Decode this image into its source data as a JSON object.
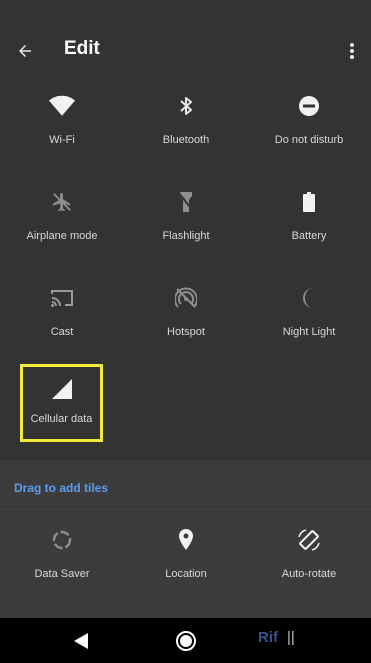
{
  "header": {
    "title": "Edit"
  },
  "tiles": [
    {
      "label": "Wi-Fi",
      "icon": "wifi-icon"
    },
    {
      "label": "Bluetooth",
      "icon": "bluetooth-icon"
    },
    {
      "label": "Do not disturb",
      "icon": "do-not-disturb-icon"
    },
    {
      "label": "Airplane mode",
      "icon": "airplane-icon"
    },
    {
      "label": "Flashlight",
      "icon": "flashlight-icon"
    },
    {
      "label": "Battery",
      "icon": "battery-icon"
    },
    {
      "label": "Cast",
      "icon": "cast-icon"
    },
    {
      "label": "Hotspot",
      "icon": "hotspot-icon"
    },
    {
      "label": "Night Light",
      "icon": "night-light-icon"
    },
    {
      "label": "Cellular data",
      "icon": "cellular-signal-icon"
    }
  ],
  "drag_section": {
    "title": "Drag to add tiles",
    "tiles": [
      {
        "label": "Data Saver",
        "icon": "data-saver-icon"
      },
      {
        "label": "Location",
        "icon": "location-icon"
      },
      {
        "label": "Auto-rotate",
        "icon": "auto-rotate-icon"
      }
    ]
  },
  "watermark": {
    "text": "Rif",
    "sub": "||"
  },
  "colors": {
    "background": "#333333",
    "highlight": "#f1ec3a",
    "accent": "#5c9cf0"
  }
}
